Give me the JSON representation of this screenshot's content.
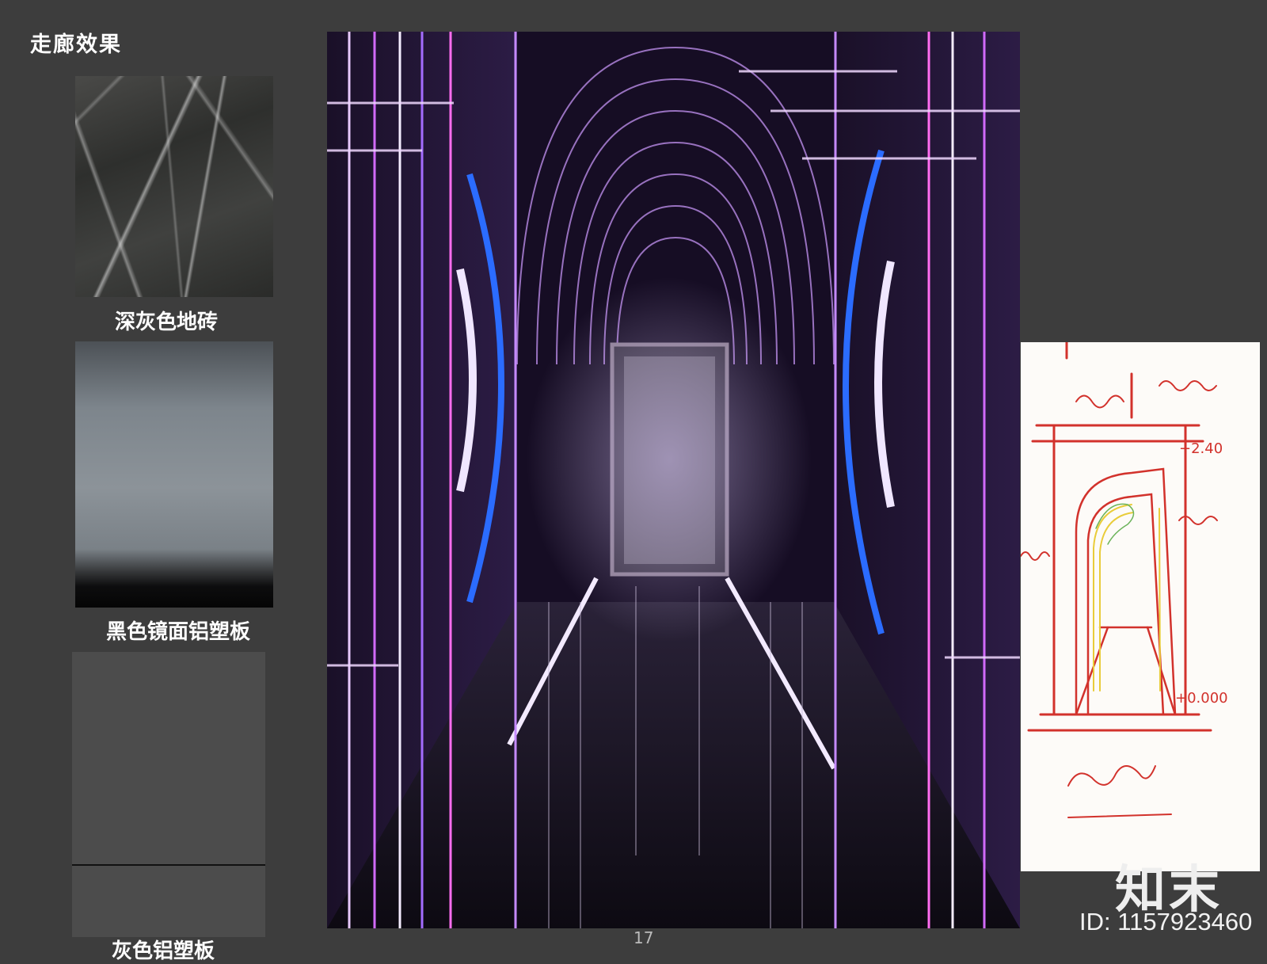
{
  "title": "走廊效果",
  "materials": [
    {
      "label": "深灰色地砖",
      "icon": "dark-gray-marble-tile"
    },
    {
      "label": "黑色镜面铝塑板",
      "icon": "black-mirror-aluminum-panel"
    },
    {
      "label": "灰色铝塑板",
      "icon": "gray-aluminum-panel"
    }
  ],
  "render": {
    "icon": "neon-corridor-rendering"
  },
  "sketch": {
    "icon": "hand-drawn-corridor-elevation-sketch",
    "annotations": {
      "level_top": "+2.40",
      "level_floor": "+0.000"
    }
  },
  "watermark": {
    "brand": "知末",
    "id": "ID: 1157923460"
  },
  "page_number": "17"
}
